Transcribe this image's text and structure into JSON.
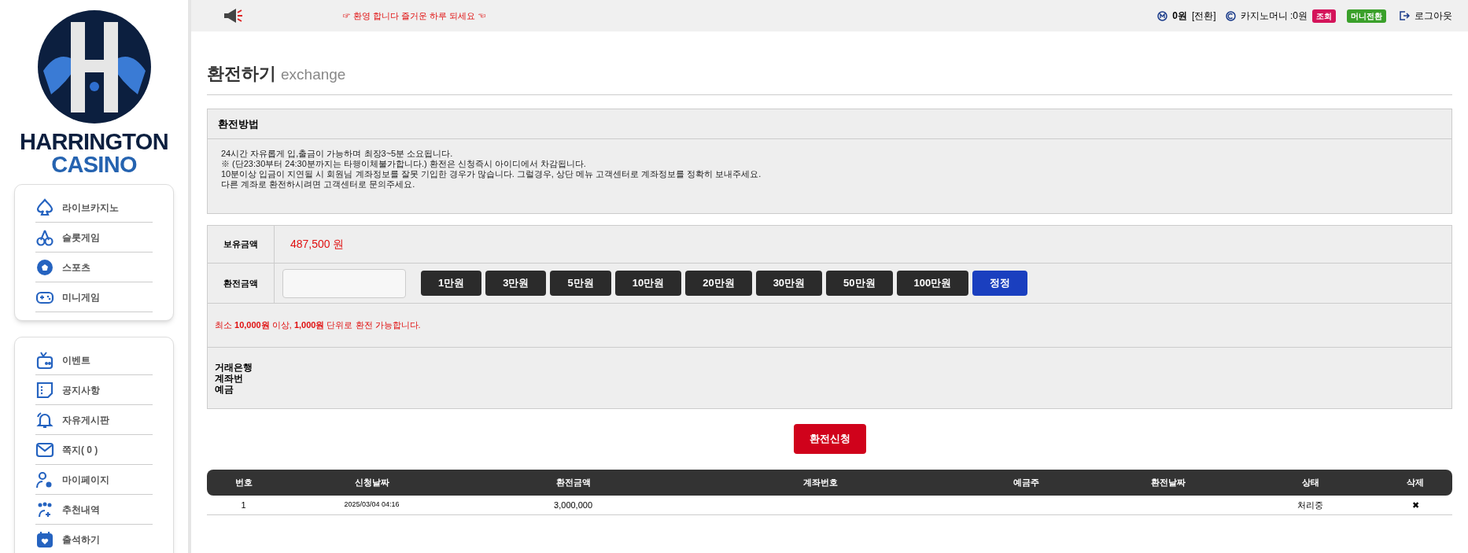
{
  "logo": {
    "line1": "HARRINGTON",
    "line2": "CASINO"
  },
  "menu_groups": [
    {
      "items": [
        {
          "label": "라이브카지노"
        },
        {
          "label": "슬롯게임"
        },
        {
          "label": "스포츠"
        },
        {
          "label": "미니게임"
        }
      ]
    },
    {
      "items": [
        {
          "label": "이벤트"
        },
        {
          "label": "공지사항"
        },
        {
          "label": "자유게시판"
        },
        {
          "label": "쪽지( 0 )"
        },
        {
          "label": "마이페이지"
        },
        {
          "label": "추천내역"
        },
        {
          "label": "출석하기"
        }
      ]
    }
  ],
  "top_bar": {
    "notice": "☞ 환영 합니다 즐거운 하루 되세요 ☜",
    "money": "0원",
    "convert": "[전환]",
    "casino_money": "카지노머니 :0원",
    "inquiry_badge": "조회",
    "mini_badge": "머니전환",
    "logout": "로그아웃"
  },
  "page_title": {
    "title": "환전하기",
    "subtitle": "exchange"
  },
  "method": {
    "heading": "환전방법",
    "lines": [
      "24시간 자유롭게 입,출금이 가능하며 최장3~5분 소요됩니다.",
      "※ (단23:30부터 24:30분까지는 타행이체불가합니다.) 환전은 신청즉시 아이디에서 차감됩니다.",
      "10분이상 입금이 지연될 시 회원님 계좌정보를 잘못 기입한 경우가 많습니다. 그럴경우, 상단 메뉴 고객센터로 계좌정보를 정확히 보내주세요.",
      "다른 계좌로 환전하시려면 고객센터로 문의주세요."
    ]
  },
  "form": {
    "balance_label": "보유금액",
    "balance": "487,500 원",
    "amount_label": "환전금액",
    "amount_buttons": [
      {
        "label": "1만원",
        "kind": "amount"
      },
      {
        "label": "3만원",
        "kind": "amount"
      },
      {
        "label": "5만원",
        "kind": "amount"
      },
      {
        "label": "10만원",
        "kind": "amount"
      },
      {
        "label": "20만원",
        "kind": "amount"
      },
      {
        "label": "30만원",
        "kind": "amount"
      },
      {
        "label": "50만원",
        "kind": "amount"
      },
      {
        "label": "100만원",
        "kind": "amount"
      },
      {
        "label": "정정",
        "kind": "reset"
      }
    ],
    "rule": "최소 **10,000원** 이상, **1,000원**  단위로 환전 가능합니다.",
    "bank_lines": [
      "거래은행",
      "계좌번",
      "예금"
    ]
  },
  "submit": "환전신청",
  "table": {
    "columns": [
      "번호",
      "신청날짜",
      "환전금액",
      "계좌번호",
      "예금주",
      "환전날짜",
      "상태",
      "삭제"
    ],
    "rows": [
      {
        "cells": [
          "1",
          "2025/03/04 04:16",
          "3,000,000",
          "",
          "",
          "",
          "처리중",
          "✖"
        ]
      }
    ]
  }
}
